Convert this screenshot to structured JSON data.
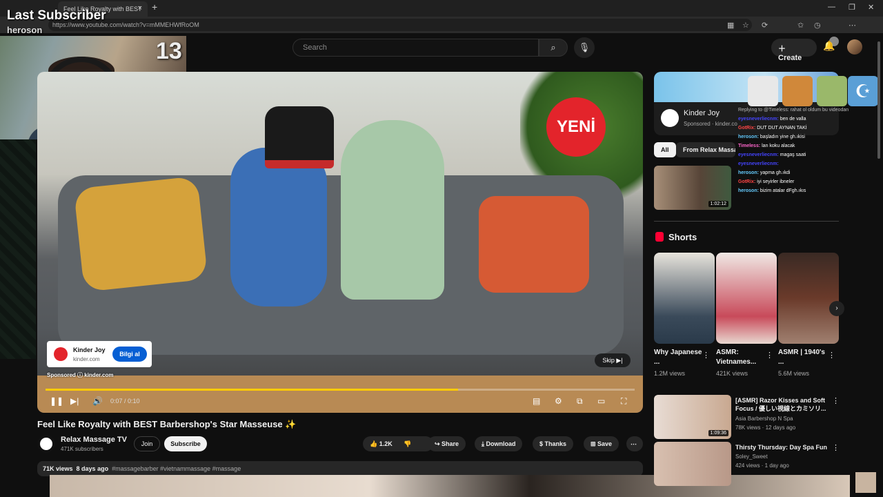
{
  "browser": {
    "tab_title": "Feel Like Royalty with BEST B",
    "tab_close": "×",
    "new_tab": "+",
    "url": "https://www.youtube.com/watch?v=mMMEHWfRoOM",
    "window_controls": [
      "—",
      "❐",
      "✕"
    ]
  },
  "overlay": {
    "last_subscriber_label": "Last Subscriber",
    "subscriber_name": "heroson",
    "counter": "13"
  },
  "header": {
    "search_placeholder": "Search",
    "search_icon": "⌕",
    "mic_icon": "🎤",
    "create_label": "Create",
    "bell_icon": "🔔"
  },
  "ad": {
    "badge_text": "YENİ",
    "advertiser": "Kinder Joy",
    "domain": "kinder.com",
    "cta": "Bilgi al",
    "sponsored": "Sponsored",
    "sponsored_domain": "kinder.com",
    "skip": "Skip",
    "progress_fraction": 0.7
  },
  "player": {
    "time": "0:07 / 0:10"
  },
  "video": {
    "title": "Feel Like Royalty with BEST Barbershop's Star Masseuse ✨",
    "channel": "Relax Massage TV",
    "subscribers": "471K subscribers",
    "join": "Join",
    "subscribe": "Subscribe",
    "likes": "1.2K",
    "share": "Share",
    "download": "Download",
    "thanks": "Thanks",
    "save": "Save",
    "views": "71K views",
    "age": "8 days ago",
    "hashtags": "#massagebarber #vietnammassage #massage"
  },
  "sidebar": {
    "ad_name": "Kinder Joy",
    "ad_sponsored": "Sponsored · kinder.co",
    "chip_all": "All",
    "chip_from": "From Relax Massage",
    "thumb1_duration": "1:02:12",
    "shorts_title": "Shorts",
    "shorts": [
      {
        "title": "Why Japanese ...",
        "views": "1.2M views"
      },
      {
        "title": "ASMR: Vietnames...",
        "views": "421K views"
      },
      {
        "title": "ASMR | 1940's ...",
        "views": "5.6M views"
      }
    ],
    "related": [
      {
        "title": "[ASMR] Razor Kisses and Soft Focus / 優しい視線とカミソリ...",
        "channel": "Asia Barbershop N Spa",
        "meta": "78K views · 12 days ago",
        "duration": "1:09:36"
      },
      {
        "title": "Thirsty Thursday: Day Spa Fun",
        "channel": "Soley_Sweet",
        "meta": "424 views · 1 day ago",
        "duration": ""
      }
    ]
  },
  "chat": {
    "lines": [
      {
        "user": "",
        "msg": "Replying to @Timeless: rahat ol oldum bu videodan"
      },
      {
        "user": "eyesneverliecnm:",
        "msg": "ben de valla"
      },
      {
        "user": "GotRix:",
        "msg": "DUT DUT AYNAN TAKİ"
      },
      {
        "user": "heroson:",
        "msg": "başladın yine gh.ıkisi"
      },
      {
        "user": "Timeless:",
        "msg": "lan koku alacak"
      },
      {
        "user": "eyesneverliecnm:",
        "msg": "magaş saati"
      },
      {
        "user": "eyesneverliecnm:",
        "msg": ""
      },
      {
        "user": "heroson:",
        "msg": "yapma gh.ıkdi"
      },
      {
        "user": "GotRix:",
        "msg": "iyi seyirler ibneler"
      },
      {
        "user": "heroson:",
        "msg": "bizim atalar dFgh.ıkıs"
      }
    ]
  },
  "colors": {
    "accent": "#065fd4",
    "progress": "#ffcc00",
    "brand_red": "#e3242b"
  }
}
